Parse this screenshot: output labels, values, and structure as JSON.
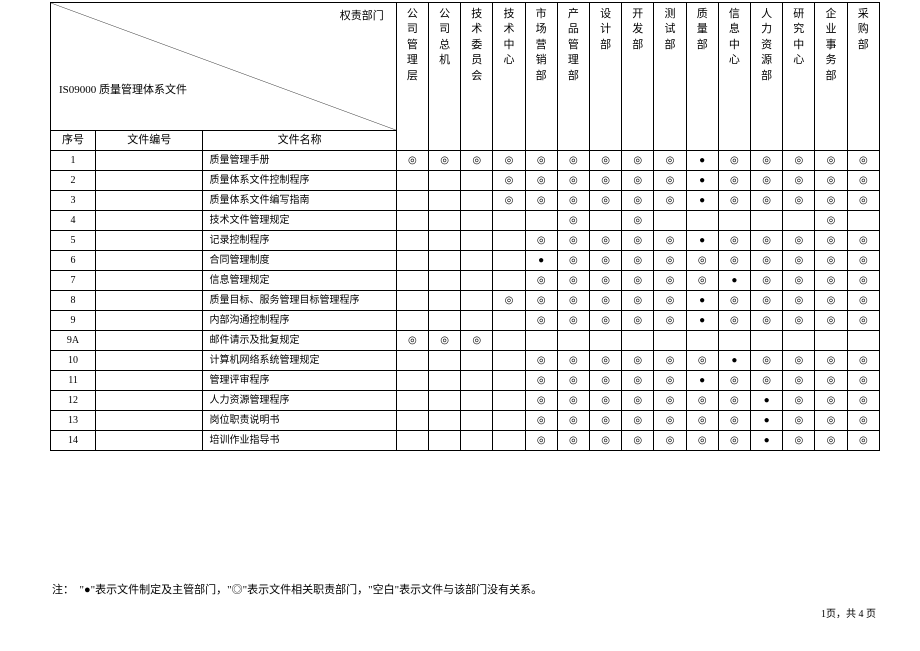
{
  "diagonal": {
    "top": "权责部门",
    "bottom": "IS09000 质量管理体系文件"
  },
  "departments": [
    "公司管理层",
    "公司总机",
    "技术委员会",
    "技术中心",
    "市场营销部",
    "产品管理部",
    "设计部",
    "开发部",
    "测试部",
    "质量部",
    "信息中心",
    "人力资源部",
    "研究中心",
    "企业事务部",
    "采购部"
  ],
  "headers": {
    "seq": "序号",
    "num": "文件编号",
    "name": "文件名称"
  },
  "rows": [
    {
      "seq": "1",
      "num": "",
      "name": "质量管理手册",
      "marks": [
        "◎",
        "◎",
        "◎",
        "◎",
        "◎",
        "◎",
        "◎",
        "◎",
        "◎",
        "●",
        "◎",
        "◎",
        "◎",
        "◎",
        "◎"
      ]
    },
    {
      "seq": "2",
      "num": "",
      "name": "质量体系文件控制程序",
      "marks": [
        "",
        "",
        "",
        "◎",
        "◎",
        "◎",
        "◎",
        "◎",
        "◎",
        "●",
        "◎",
        "◎",
        "◎",
        "◎",
        "◎"
      ]
    },
    {
      "seq": "3",
      "num": "",
      "name": "质量体系文件编写指南",
      "marks": [
        "",
        "",
        "",
        "◎",
        "◎",
        "◎",
        "◎",
        "◎",
        "◎",
        "●",
        "◎",
        "◎",
        "◎",
        "◎",
        "◎"
      ]
    },
    {
      "seq": "4",
      "num": "",
      "name": "技术文件管理规定",
      "marks": [
        "",
        "",
        "",
        "",
        "",
        "◎",
        "",
        "◎",
        "",
        "",
        "",
        "",
        "",
        "◎",
        ""
      ]
    },
    {
      "seq": "5",
      "num": "",
      "name": "记录控制程序",
      "marks": [
        "",
        "",
        "",
        "",
        "◎",
        "◎",
        "◎",
        "◎",
        "◎",
        "●",
        "◎",
        "◎",
        "◎",
        "◎",
        "◎"
      ]
    },
    {
      "seq": "6",
      "num": "",
      "name": "合同管理制度",
      "marks": [
        "",
        "",
        "",
        "",
        "●",
        "◎",
        "◎",
        "◎",
        "◎",
        "◎",
        "◎",
        "◎",
        "◎",
        "◎",
        "◎"
      ]
    },
    {
      "seq": "7",
      "num": "",
      "name": "信息管理规定",
      "marks": [
        "",
        "",
        "",
        "",
        "◎",
        "◎",
        "◎",
        "◎",
        "◎",
        "◎",
        "●",
        "◎",
        "◎",
        "◎",
        "◎"
      ]
    },
    {
      "seq": "8",
      "num": "",
      "name": "质量目标、服务管理目标管理程序",
      "marks": [
        "",
        "",
        "",
        "◎",
        "◎",
        "◎",
        "◎",
        "◎",
        "◎",
        "●",
        "◎",
        "◎",
        "◎",
        "◎",
        "◎"
      ]
    },
    {
      "seq": "9",
      "num": "",
      "name": "内部沟通控制程序",
      "marks": [
        "",
        "",
        "",
        "",
        "◎",
        "◎",
        "◎",
        "◎",
        "◎",
        "●",
        "◎",
        "◎",
        "◎",
        "◎",
        "◎"
      ]
    },
    {
      "seq": "9A",
      "num": "",
      "name": "邮件请示及批复规定",
      "marks": [
        "◎",
        "◎",
        "◎",
        "",
        "",
        "",
        "",
        "",
        "",
        "",
        "",
        "",
        "",
        "",
        ""
      ]
    },
    {
      "seq": "10",
      "num": "",
      "name": "计算机网络系统管理规定",
      "marks": [
        "",
        "",
        "",
        "",
        "◎",
        "◎",
        "◎",
        "◎",
        "◎",
        "◎",
        "●",
        "◎",
        "◎",
        "◎",
        "◎"
      ]
    },
    {
      "seq": "11",
      "num": "",
      "name": "管理评审程序",
      "marks": [
        "",
        "",
        "",
        "",
        "◎",
        "◎",
        "◎",
        "◎",
        "◎",
        "●",
        "◎",
        "◎",
        "◎",
        "◎",
        "◎"
      ]
    },
    {
      "seq": "12",
      "num": "",
      "name": "人力资源管理程序",
      "marks": [
        "",
        "",
        "",
        "",
        "◎",
        "◎",
        "◎",
        "◎",
        "◎",
        "◎",
        "◎",
        "●",
        "◎",
        "◎",
        "◎"
      ]
    },
    {
      "seq": "13",
      "num": "",
      "name": "岗位职责说明书",
      "marks": [
        "",
        "",
        "",
        "",
        "◎",
        "◎",
        "◎",
        "◎",
        "◎",
        "◎",
        "◎",
        "●",
        "◎",
        "◎",
        "◎"
      ]
    },
    {
      "seq": "14",
      "num": "",
      "name": "培训作业指导书",
      "marks": [
        "",
        "",
        "",
        "",
        "◎",
        "◎",
        "◎",
        "◎",
        "◎",
        "◎",
        "◎",
        "●",
        "◎",
        "◎",
        "◎"
      ]
    }
  ],
  "footnote": "注：　\"●\"表示文件制定及主管部门，\"◎\"表示文件相关职责部门，\"空白\"表示文件与该部门没有关系。",
  "page": "1页，共 4 页"
}
